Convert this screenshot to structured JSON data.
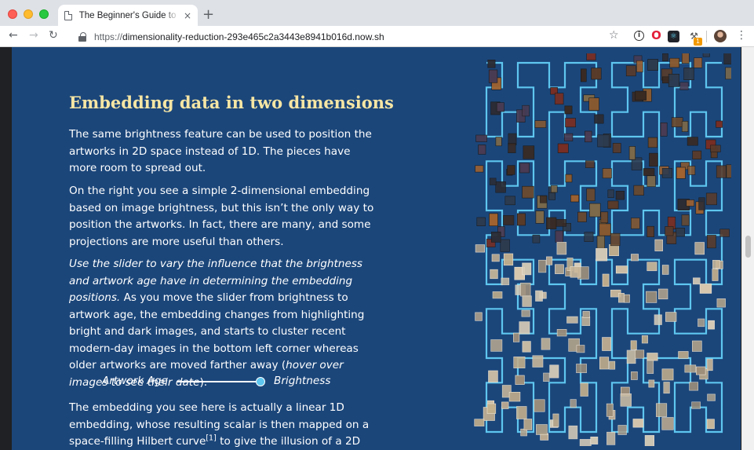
{
  "browser": {
    "tab_title": "The Beginner's Guide to Dimensionality Reduction",
    "tab_close": "×",
    "new_tab": "+",
    "url_scheme": "https://",
    "url_host": "dimensionality-reduction-293e465c2a3443e8941b016d.now.sh",
    "extension_badge": "1",
    "icons": [
      "back-arrow-icon",
      "forward-arrow-icon",
      "reload-icon",
      "lock-icon",
      "star-icon",
      "info-icon",
      "opera-icon",
      "react-devtools-icon",
      "hammer-icon",
      "avatar",
      "kebab-menu-icon"
    ]
  },
  "article": {
    "heading": "Embedding data in two dimensions",
    "p1": "The same brightness feature can be used to position the artworks in 2D space instead of 1D. The pieces have more room to spread out.",
    "p2": "On the right you see a simple 2-dimensional embedding based on image brightness, but this isn’t the only way to position the artworks. In fact, there are many, and some projections are more useful than others.",
    "p3_italic": "Use the slider to vary the influence that the brightness and artwork age have in determining the embedding positions.",
    "p3_main": " As you move the slider from brightness to artwork age, the embedding changes from highlighting bright and dark images, and starts to cluster recent modern-day images in the bottom left corner whereas older artworks are moved farther away (",
    "p3_hint": "hover over images to see their date",
    "p3_end": ").",
    "slider_left_label": "Artwork Age",
    "slider_right_label": "Brightness",
    "slider_value": 1.0,
    "p4_start": "The embedding you see here is actually a linear 1D embedding, whose resulting scalar is then mapped on a space-filling Hilbert curve",
    "p4_ref": "[1]",
    "p4_end": " to give the illusion of a 2D"
  },
  "colors": {
    "page_background": "#1b467a",
    "heading": "#f6e6a4",
    "curve": "#5ec6ef"
  }
}
